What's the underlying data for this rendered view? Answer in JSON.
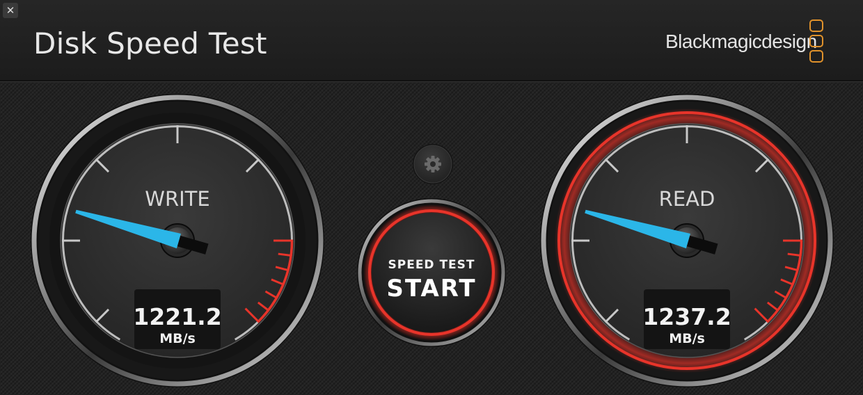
{
  "window": {
    "close_label": "✕",
    "title": "Disk Speed Test"
  },
  "brand": {
    "name": "Blackmagicdesign",
    "accent_color": "#e0922b"
  },
  "settings": {
    "icon": "gear-icon"
  },
  "start_button": {
    "line1": "SPEED TEST",
    "line2": "START",
    "ring_color": "#e8342a"
  },
  "gauges": {
    "write": {
      "label": "WRITE",
      "value": "1221.2",
      "unit": "MB/s",
      "active": false
    },
    "read": {
      "label": "READ",
      "value": "1237.2",
      "unit": "MB/s",
      "active": true
    }
  },
  "colors": {
    "needle": "#2bb6e8",
    "redline": "#e8342a"
  }
}
